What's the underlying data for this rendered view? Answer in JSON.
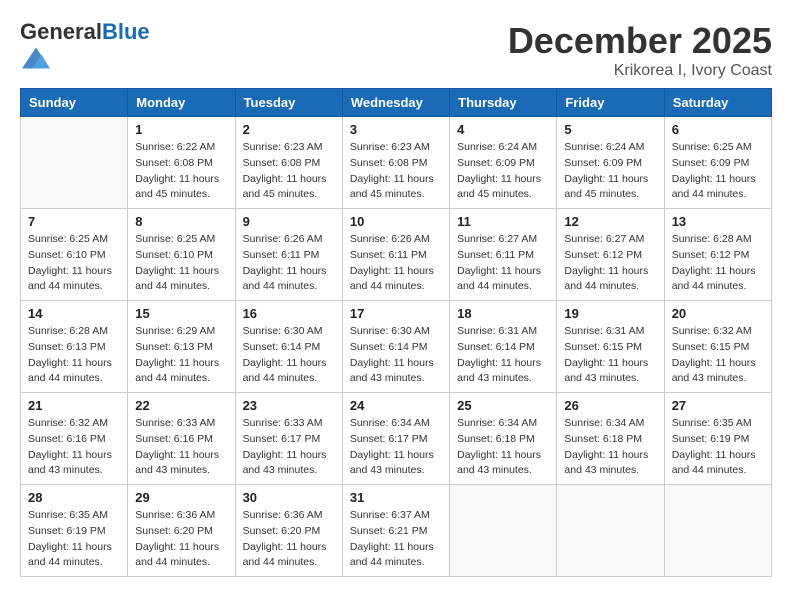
{
  "logo": {
    "general": "General",
    "blue": "Blue"
  },
  "header": {
    "month": "December 2025",
    "location": "Krikorea I, Ivory Coast"
  },
  "weekdays": [
    "Sunday",
    "Monday",
    "Tuesday",
    "Wednesday",
    "Thursday",
    "Friday",
    "Saturday"
  ],
  "weeks": [
    [
      {
        "day": "",
        "info": ""
      },
      {
        "day": "1",
        "info": "Sunrise: 6:22 AM\nSunset: 6:08 PM\nDaylight: 11 hours\nand 45 minutes."
      },
      {
        "day": "2",
        "info": "Sunrise: 6:23 AM\nSunset: 6:08 PM\nDaylight: 11 hours\nand 45 minutes."
      },
      {
        "day": "3",
        "info": "Sunrise: 6:23 AM\nSunset: 6:08 PM\nDaylight: 11 hours\nand 45 minutes."
      },
      {
        "day": "4",
        "info": "Sunrise: 6:24 AM\nSunset: 6:09 PM\nDaylight: 11 hours\nand 45 minutes."
      },
      {
        "day": "5",
        "info": "Sunrise: 6:24 AM\nSunset: 6:09 PM\nDaylight: 11 hours\nand 45 minutes."
      },
      {
        "day": "6",
        "info": "Sunrise: 6:25 AM\nSunset: 6:09 PM\nDaylight: 11 hours\nand 44 minutes."
      }
    ],
    [
      {
        "day": "7",
        "info": "Sunrise: 6:25 AM\nSunset: 6:10 PM\nDaylight: 11 hours\nand 44 minutes."
      },
      {
        "day": "8",
        "info": "Sunrise: 6:25 AM\nSunset: 6:10 PM\nDaylight: 11 hours\nand 44 minutes."
      },
      {
        "day": "9",
        "info": "Sunrise: 6:26 AM\nSunset: 6:11 PM\nDaylight: 11 hours\nand 44 minutes."
      },
      {
        "day": "10",
        "info": "Sunrise: 6:26 AM\nSunset: 6:11 PM\nDaylight: 11 hours\nand 44 minutes."
      },
      {
        "day": "11",
        "info": "Sunrise: 6:27 AM\nSunset: 6:11 PM\nDaylight: 11 hours\nand 44 minutes."
      },
      {
        "day": "12",
        "info": "Sunrise: 6:27 AM\nSunset: 6:12 PM\nDaylight: 11 hours\nand 44 minutes."
      },
      {
        "day": "13",
        "info": "Sunrise: 6:28 AM\nSunset: 6:12 PM\nDaylight: 11 hours\nand 44 minutes."
      }
    ],
    [
      {
        "day": "14",
        "info": "Sunrise: 6:28 AM\nSunset: 6:13 PM\nDaylight: 11 hours\nand 44 minutes."
      },
      {
        "day": "15",
        "info": "Sunrise: 6:29 AM\nSunset: 6:13 PM\nDaylight: 11 hours\nand 44 minutes."
      },
      {
        "day": "16",
        "info": "Sunrise: 6:30 AM\nSunset: 6:14 PM\nDaylight: 11 hours\nand 44 minutes."
      },
      {
        "day": "17",
        "info": "Sunrise: 6:30 AM\nSunset: 6:14 PM\nDaylight: 11 hours\nand 43 minutes."
      },
      {
        "day": "18",
        "info": "Sunrise: 6:31 AM\nSunset: 6:14 PM\nDaylight: 11 hours\nand 43 minutes."
      },
      {
        "day": "19",
        "info": "Sunrise: 6:31 AM\nSunset: 6:15 PM\nDaylight: 11 hours\nand 43 minutes."
      },
      {
        "day": "20",
        "info": "Sunrise: 6:32 AM\nSunset: 6:15 PM\nDaylight: 11 hours\nand 43 minutes."
      }
    ],
    [
      {
        "day": "21",
        "info": "Sunrise: 6:32 AM\nSunset: 6:16 PM\nDaylight: 11 hours\nand 43 minutes."
      },
      {
        "day": "22",
        "info": "Sunrise: 6:33 AM\nSunset: 6:16 PM\nDaylight: 11 hours\nand 43 minutes."
      },
      {
        "day": "23",
        "info": "Sunrise: 6:33 AM\nSunset: 6:17 PM\nDaylight: 11 hours\nand 43 minutes."
      },
      {
        "day": "24",
        "info": "Sunrise: 6:34 AM\nSunset: 6:17 PM\nDaylight: 11 hours\nand 43 minutes."
      },
      {
        "day": "25",
        "info": "Sunrise: 6:34 AM\nSunset: 6:18 PM\nDaylight: 11 hours\nand 43 minutes."
      },
      {
        "day": "26",
        "info": "Sunrise: 6:34 AM\nSunset: 6:18 PM\nDaylight: 11 hours\nand 43 minutes."
      },
      {
        "day": "27",
        "info": "Sunrise: 6:35 AM\nSunset: 6:19 PM\nDaylight: 11 hours\nand 44 minutes."
      }
    ],
    [
      {
        "day": "28",
        "info": "Sunrise: 6:35 AM\nSunset: 6:19 PM\nDaylight: 11 hours\nand 44 minutes."
      },
      {
        "day": "29",
        "info": "Sunrise: 6:36 AM\nSunset: 6:20 PM\nDaylight: 11 hours\nand 44 minutes."
      },
      {
        "day": "30",
        "info": "Sunrise: 6:36 AM\nSunset: 6:20 PM\nDaylight: 11 hours\nand 44 minutes."
      },
      {
        "day": "31",
        "info": "Sunrise: 6:37 AM\nSunset: 6:21 PM\nDaylight: 11 hours\nand 44 minutes."
      },
      {
        "day": "",
        "info": ""
      },
      {
        "day": "",
        "info": ""
      },
      {
        "day": "",
        "info": ""
      }
    ]
  ]
}
